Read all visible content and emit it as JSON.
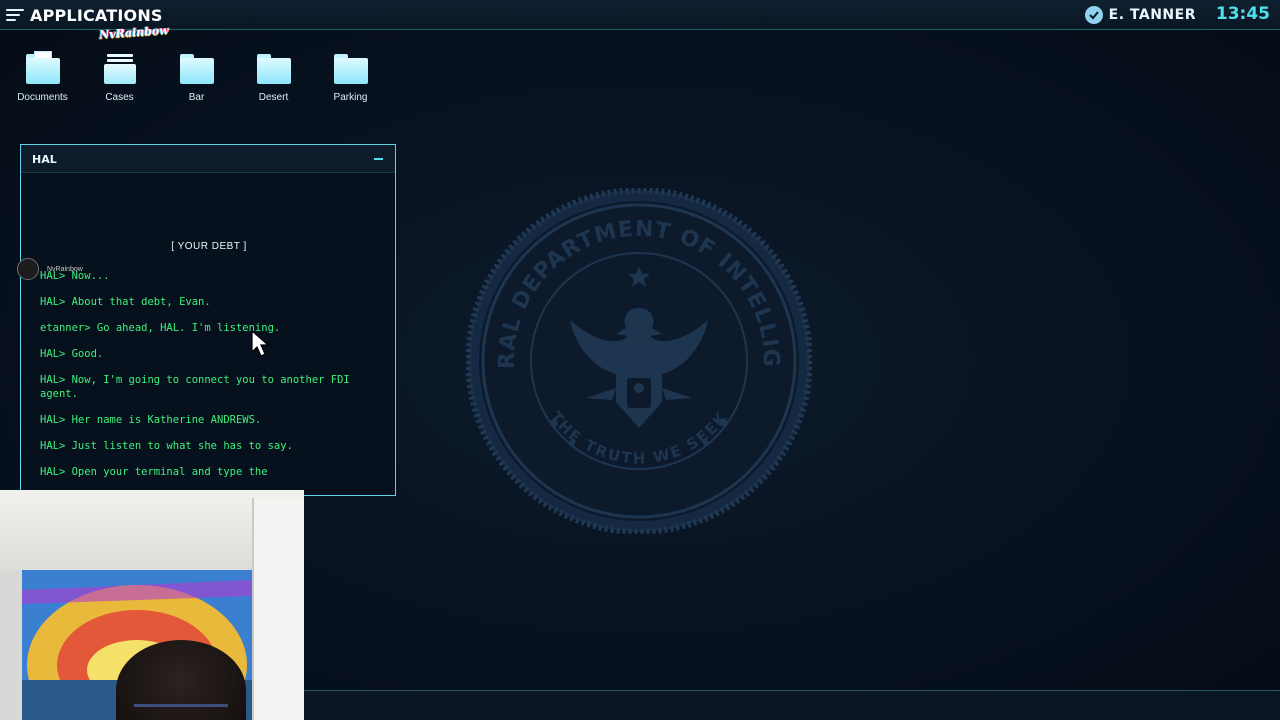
{
  "topbar": {
    "apps_label": "APPLICATIONS",
    "overlay_logo": "NvRainbow",
    "user_name": "E. TANNER",
    "clock": "13:45"
  },
  "desktop": {
    "icons": [
      {
        "label": "Documents",
        "icon": "document-folder-icon"
      },
      {
        "label": "Cases",
        "icon": "cases-tray-icon"
      },
      {
        "label": "Bar",
        "icon": "folder-icon"
      },
      {
        "label": "Desert",
        "icon": "folder-icon"
      },
      {
        "label": "Parking",
        "icon": "folder-icon"
      }
    ]
  },
  "hal_window": {
    "title": "HAL",
    "heading": "[  YOUR DEBT  ]",
    "lines": [
      "HAL> Now...",
      "HAL> About that debt, Evan.",
      "etanner> Go ahead, HAL. I'm listening.",
      "HAL> Good.",
      "HAL> Now, I'm going to connect you to another FDI agent.",
      "HAL> Her name is Katherine ANDREWS.",
      "HAL> Just listen to what she has to say.",
      "HAL> Open your terminal and type the"
    ],
    "chat_overlay_name": "NvRainbow"
  },
  "seal": {
    "top_text": "FEDERAL DEPARTMENT OF INTELLIGENCE",
    "bottom_text": "THE TRUTH WE SEEK"
  },
  "colors": {
    "accent": "#4fe0e8",
    "terminal_green": "#3ff07b",
    "background": "#081321",
    "seal": "#1e3550"
  }
}
